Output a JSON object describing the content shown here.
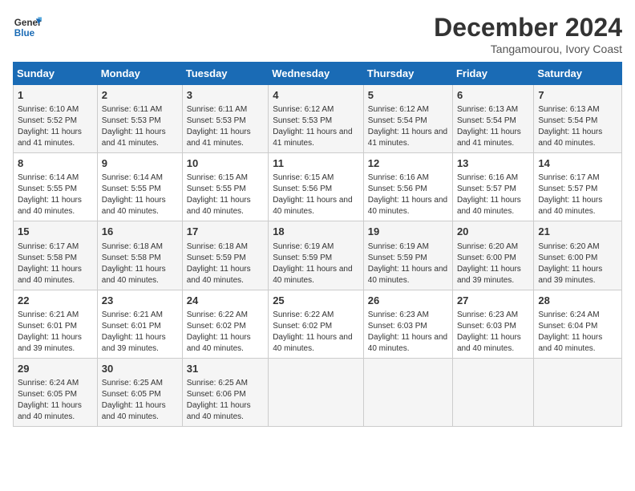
{
  "header": {
    "logo_line1": "General",
    "logo_line2": "Blue",
    "month": "December 2024",
    "location": "Tangamourou, Ivory Coast"
  },
  "weekdays": [
    "Sunday",
    "Monday",
    "Tuesday",
    "Wednesday",
    "Thursday",
    "Friday",
    "Saturday"
  ],
  "weeks": [
    [
      {
        "day": "1",
        "info": "Sunrise: 6:10 AM\nSunset: 5:52 PM\nDaylight: 11 hours and 41 minutes."
      },
      {
        "day": "2",
        "info": "Sunrise: 6:11 AM\nSunset: 5:53 PM\nDaylight: 11 hours and 41 minutes."
      },
      {
        "day": "3",
        "info": "Sunrise: 6:11 AM\nSunset: 5:53 PM\nDaylight: 11 hours and 41 minutes."
      },
      {
        "day": "4",
        "info": "Sunrise: 6:12 AM\nSunset: 5:53 PM\nDaylight: 11 hours and 41 minutes."
      },
      {
        "day": "5",
        "info": "Sunrise: 6:12 AM\nSunset: 5:54 PM\nDaylight: 11 hours and 41 minutes."
      },
      {
        "day": "6",
        "info": "Sunrise: 6:13 AM\nSunset: 5:54 PM\nDaylight: 11 hours and 41 minutes."
      },
      {
        "day": "7",
        "info": "Sunrise: 6:13 AM\nSunset: 5:54 PM\nDaylight: 11 hours and 40 minutes."
      }
    ],
    [
      {
        "day": "8",
        "info": "Sunrise: 6:14 AM\nSunset: 5:55 PM\nDaylight: 11 hours and 40 minutes."
      },
      {
        "day": "9",
        "info": "Sunrise: 6:14 AM\nSunset: 5:55 PM\nDaylight: 11 hours and 40 minutes."
      },
      {
        "day": "10",
        "info": "Sunrise: 6:15 AM\nSunset: 5:55 PM\nDaylight: 11 hours and 40 minutes."
      },
      {
        "day": "11",
        "info": "Sunrise: 6:15 AM\nSunset: 5:56 PM\nDaylight: 11 hours and 40 minutes."
      },
      {
        "day": "12",
        "info": "Sunrise: 6:16 AM\nSunset: 5:56 PM\nDaylight: 11 hours and 40 minutes."
      },
      {
        "day": "13",
        "info": "Sunrise: 6:16 AM\nSunset: 5:57 PM\nDaylight: 11 hours and 40 minutes."
      },
      {
        "day": "14",
        "info": "Sunrise: 6:17 AM\nSunset: 5:57 PM\nDaylight: 11 hours and 40 minutes."
      }
    ],
    [
      {
        "day": "15",
        "info": "Sunrise: 6:17 AM\nSunset: 5:58 PM\nDaylight: 11 hours and 40 minutes."
      },
      {
        "day": "16",
        "info": "Sunrise: 6:18 AM\nSunset: 5:58 PM\nDaylight: 11 hours and 40 minutes."
      },
      {
        "day": "17",
        "info": "Sunrise: 6:18 AM\nSunset: 5:59 PM\nDaylight: 11 hours and 40 minutes."
      },
      {
        "day": "18",
        "info": "Sunrise: 6:19 AM\nSunset: 5:59 PM\nDaylight: 11 hours and 40 minutes."
      },
      {
        "day": "19",
        "info": "Sunrise: 6:19 AM\nSunset: 5:59 PM\nDaylight: 11 hours and 40 minutes."
      },
      {
        "day": "20",
        "info": "Sunrise: 6:20 AM\nSunset: 6:00 PM\nDaylight: 11 hours and 39 minutes."
      },
      {
        "day": "21",
        "info": "Sunrise: 6:20 AM\nSunset: 6:00 PM\nDaylight: 11 hours and 39 minutes."
      }
    ],
    [
      {
        "day": "22",
        "info": "Sunrise: 6:21 AM\nSunset: 6:01 PM\nDaylight: 11 hours and 39 minutes."
      },
      {
        "day": "23",
        "info": "Sunrise: 6:21 AM\nSunset: 6:01 PM\nDaylight: 11 hours and 39 minutes."
      },
      {
        "day": "24",
        "info": "Sunrise: 6:22 AM\nSunset: 6:02 PM\nDaylight: 11 hours and 40 minutes."
      },
      {
        "day": "25",
        "info": "Sunrise: 6:22 AM\nSunset: 6:02 PM\nDaylight: 11 hours and 40 minutes."
      },
      {
        "day": "26",
        "info": "Sunrise: 6:23 AM\nSunset: 6:03 PM\nDaylight: 11 hours and 40 minutes."
      },
      {
        "day": "27",
        "info": "Sunrise: 6:23 AM\nSunset: 6:03 PM\nDaylight: 11 hours and 40 minutes."
      },
      {
        "day": "28",
        "info": "Sunrise: 6:24 AM\nSunset: 6:04 PM\nDaylight: 11 hours and 40 minutes."
      }
    ],
    [
      {
        "day": "29",
        "info": "Sunrise: 6:24 AM\nSunset: 6:05 PM\nDaylight: 11 hours and 40 minutes."
      },
      {
        "day": "30",
        "info": "Sunrise: 6:25 AM\nSunset: 6:05 PM\nDaylight: 11 hours and 40 minutes."
      },
      {
        "day": "31",
        "info": "Sunrise: 6:25 AM\nSunset: 6:06 PM\nDaylight: 11 hours and 40 minutes."
      },
      {
        "day": "",
        "info": ""
      },
      {
        "day": "",
        "info": ""
      },
      {
        "day": "",
        "info": ""
      },
      {
        "day": "",
        "info": ""
      }
    ]
  ]
}
